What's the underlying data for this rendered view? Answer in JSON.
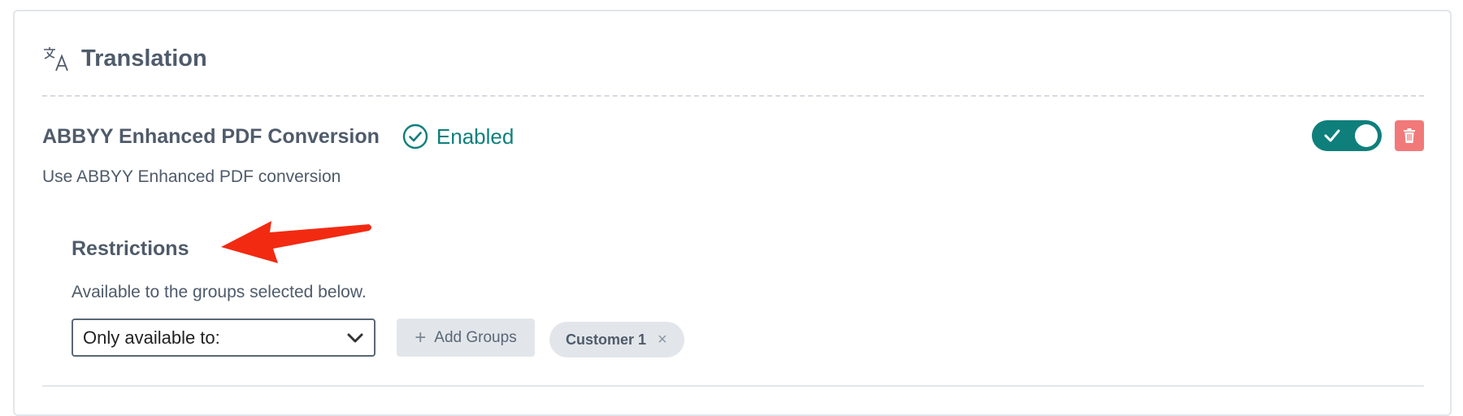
{
  "section": {
    "title": "Translation",
    "icon": "translate-icon"
  },
  "feature": {
    "title": "ABBYY Enhanced PDF Conversion",
    "status_label": "Enabled",
    "status_icon": "check-circle-icon",
    "description": "Use ABBYY Enhanced PDF conversion",
    "enabled": true
  },
  "restrictions": {
    "title": "Restrictions",
    "description": "Available to the groups selected below.",
    "select_value": "Only available to:",
    "add_groups_label": "Add Groups",
    "groups": [
      "Customer 1"
    ]
  },
  "colors": {
    "accent": "#0f7f7c",
    "danger": "#f27979",
    "annotation_arrow": "#f22a12"
  }
}
